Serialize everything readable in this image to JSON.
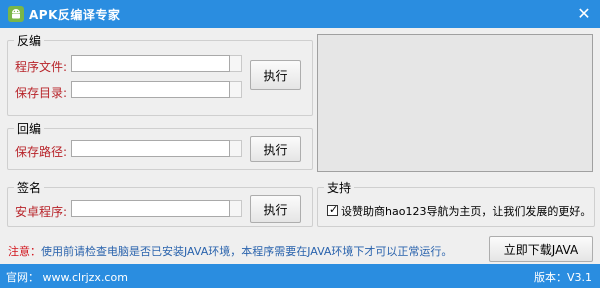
{
  "window": {
    "title": "APK反编译专家",
    "icon": "android-icon",
    "close_icon": "close-icon"
  },
  "decompile": {
    "group_label": "反编",
    "program_file_label": "程序文件:",
    "program_file_value": "",
    "save_dir_label": "保存目录:",
    "save_dir_value": "",
    "execute_label": "执行"
  },
  "recompile": {
    "group_label": "回编",
    "save_path_label": "保存路径:",
    "save_path_value": "",
    "execute_label": "执行"
  },
  "sign": {
    "group_label": "签名",
    "apk_label": "安卓程序:",
    "apk_value": "",
    "execute_label": "执行"
  },
  "support": {
    "group_label": "支持",
    "checkbox_checked": true,
    "checkbox_text": "设赞助商hao123导航为主页，让我们发展的更好。"
  },
  "notice": {
    "prefix": "注意：",
    "text": "使用前请检查电脑是否已安装JAVA环境，本程序需要在JAVA环境下才可以正常运行。"
  },
  "download_java_label": "立即下载JAVA",
  "status": {
    "website": "官网：  www.clrjzx.com",
    "version": "版本：V3.1"
  },
  "colors": {
    "titlebar": "#2a8de0",
    "label_red": "#b8242a",
    "notice_red": "#d2151d",
    "notice_blue": "#2a63ad"
  }
}
